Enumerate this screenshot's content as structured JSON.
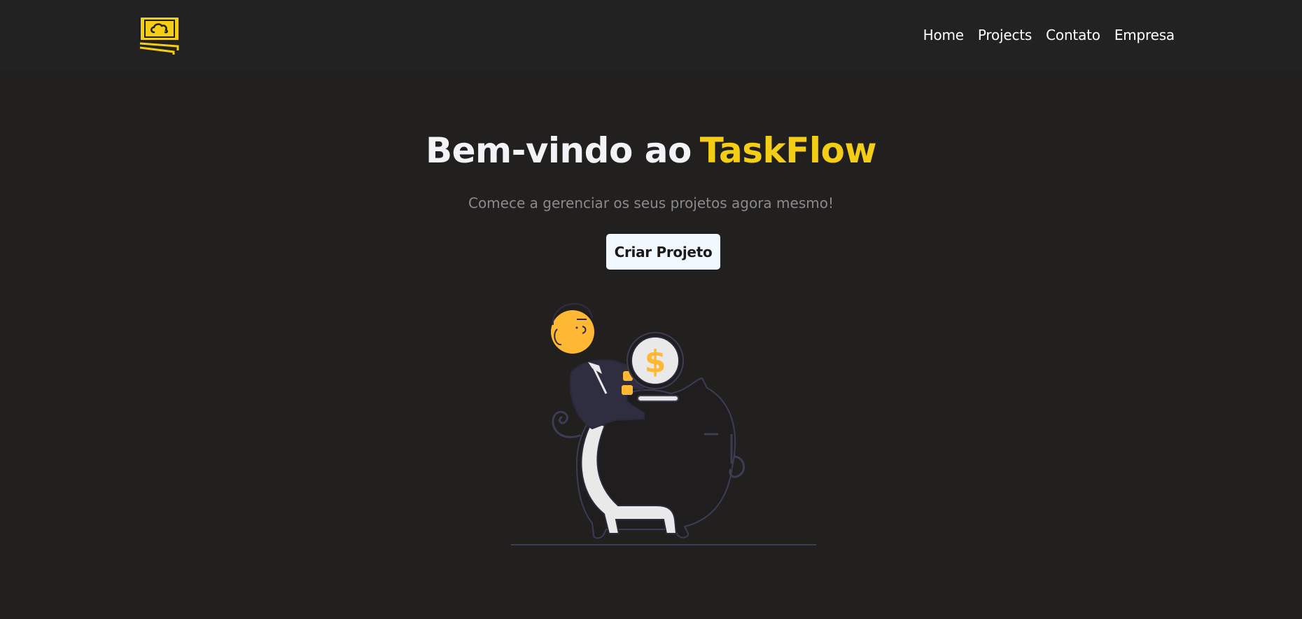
{
  "header": {
    "logo_icon": "cash-cloud-logo-icon",
    "nav": [
      {
        "label": "Home"
      },
      {
        "label": "Projects"
      },
      {
        "label": "Contato"
      },
      {
        "label": "Empresa"
      }
    ]
  },
  "hero": {
    "title_prefix": "Bem-vindo ao",
    "title_brand": "TaskFlow",
    "subtitle": "Comece a gerenciar os seus projetos agora mesmo!",
    "cta_label": "Criar Projeto",
    "illustration_icon": "person-with-coin-piggy-bank-illustration",
    "coin_symbol": "$"
  },
  "colors": {
    "background": "#221f1f",
    "header_background": "#232222",
    "accent": "#f4ce14",
    "title": "#f1f3f6",
    "subtitle": "#8a8a8a",
    "button_background": "#f2f8ff"
  }
}
